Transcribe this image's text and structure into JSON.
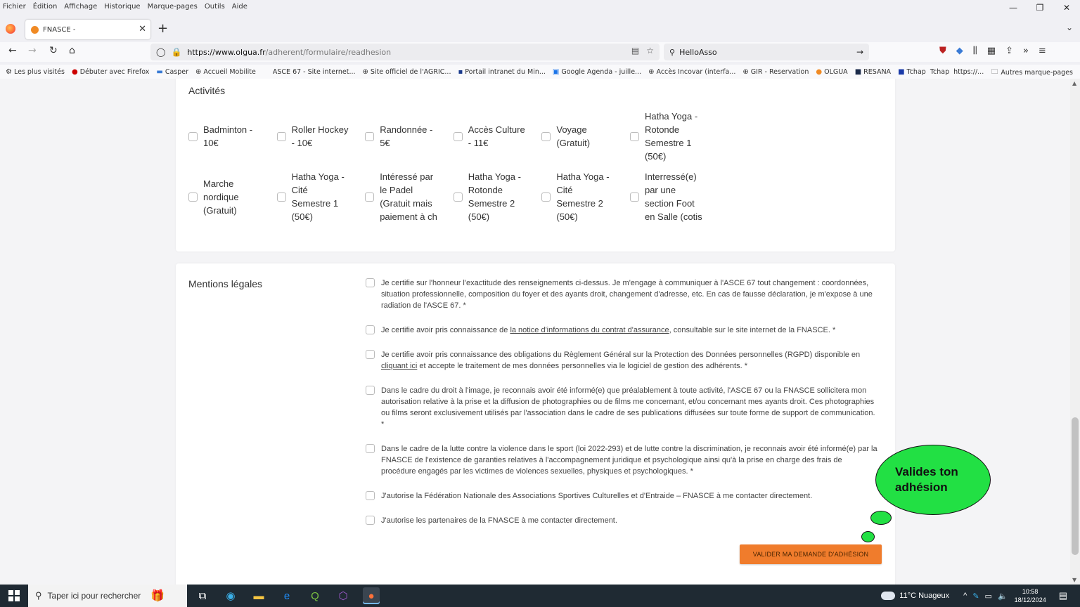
{
  "menu": [
    "Fichier",
    "Édition",
    "Affichage",
    "Historique",
    "Marque-pages",
    "Outils",
    "Aide"
  ],
  "tab": {
    "title": "FNASCE -"
  },
  "url": {
    "host": "https://www.olgua.fr",
    "path": "/adherent/formulaire/readhesion"
  },
  "search": {
    "value": "HelloAsso"
  },
  "bookmarks": [
    "Les plus visités",
    "Débuter avec Firefox",
    "Casper",
    "Accueil Mobilite",
    "ASCE 67 - Site internet...",
    "Site officiel de l'AGRIC...",
    "Portail intranet du Min...",
    "Google Agenda - juille...",
    "Accès Incovar (interfa...",
    "GIR - Reservation",
    "OLGUA",
    "RESANA",
    "Tchap",
    "Tchap",
    "https://..."
  ],
  "bookmarks_other": "Autres marque-pages",
  "activities": {
    "title": "Activités",
    "items": [
      "Badminton - 10€",
      "Roller Hockey - 10€",
      "Randonnée - 5€",
      "Accès Culture - 11€",
      "Voyage (Gratuit)",
      "Hatha Yoga - Rotonde Semestre 1 (50€)",
      "Marche nordique (Gratuit)",
      "Hatha Yoga - Cité Semestre 1 (50€)",
      "Intéressé par le Padel (Gratuit mais paiement à ch",
      "Hatha Yoga - Rotonde Semestre 2 (50€)",
      "Hatha Yoga - Cité Semestre 2 (50€)",
      "Interressé(e) par une section Foot en Salle (cotis"
    ]
  },
  "legal": {
    "title": "Mentions légales",
    "m1": "Je certifie sur l'honneur l'exactitude des renseignements ci-dessus. Je m'engage à communiquer à l'ASCE 67 tout changement : coordonnées, situation professionnelle, composition du foyer et des ayants droit, changement d'adresse, etc. En cas de fausse déclaration, je m'expose à une radiation de l'ASCE 67. *",
    "m2_before": "Je certifie avoir pris connaissance de ",
    "m2_link": "la notice d'informations du contrat d'assurance",
    "m2_after": ", consultable sur le site internet de la FNASCE. *",
    "m3_before": "Je certifie avoir pris connaissance des obligations du Règlement Général sur la Protection des Données personnelles (RGPD) disponible en ",
    "m3_link": "cliquant ici",
    "m3_after": " et accepte le traitement de mes données personnelles via le logiciel de gestion des adhérents. *",
    "m4": "Dans le cadre du droit à l'image, je reconnais avoir été informé(e) que préalablement à toute activité, l'ASCE 67 ou la FNASCE sollicitera mon autorisation relative à la prise et la diffusion de photographies ou de films me concernant, et/ou concernant mes ayants droit. Ces photographies ou films seront exclusivement utilisés par l'association dans le cadre de ses publications diffusées sur toute forme de support de communication. *",
    "m5": "Dans le cadre de la lutte contre la violence dans le sport (loi 2022-293) et de lutte contre la discrimination, je reconnais avoir été informé(e) par la FNASCE de l'existence de garanties relatives à l'accompagnement juridique et psychologique ainsi qu'à la prise en charge des frais de procédure engagés par les victimes de violences sexuelles, physiques et psychologiques. *",
    "m6": "J'autorise la Fédération Nationale des Associations Sportives Culturelles et d'Entraide – FNASCE à me contacter directement.",
    "m7": "J'autorise les partenaires de la FNASCE à me contacter directement."
  },
  "submit_label": "VALIDER MA DEMANDE D'ADHÉSION",
  "callout": {
    "line1": "Valides ton",
    "line2": "adhésion"
  },
  "taskbar": {
    "search_placeholder": "Taper ici pour rechercher",
    "weather": "11°C  Nuageux",
    "time": "10:58",
    "date": "18/12/2024"
  }
}
